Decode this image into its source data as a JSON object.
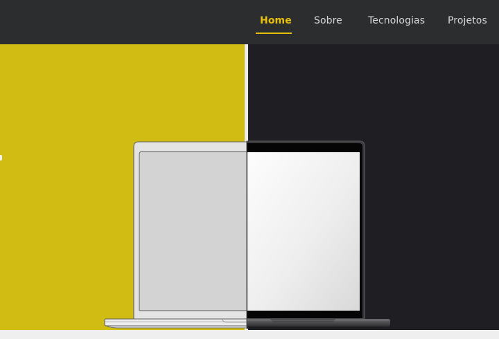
{
  "nav": {
    "items": [
      {
        "label": "Home",
        "active": true
      },
      {
        "label": "Sobre",
        "active": false
      },
      {
        "label": "Tecnologias",
        "active": false
      },
      {
        "label": "Projetos",
        "active": false
      }
    ]
  },
  "hero": {
    "illustration": "laptop-icon",
    "left_color": "#d0bc12",
    "right_color": "#1f1e23"
  },
  "colors": {
    "accent": "#e8c10d",
    "navbar": "#2c2d2f"
  }
}
